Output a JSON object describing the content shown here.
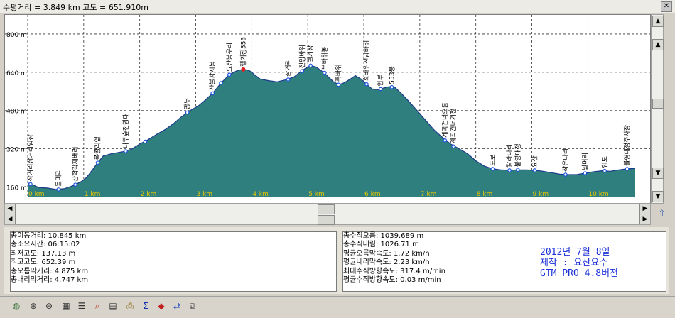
{
  "window": {
    "title": "수평거리 = 3.849 km    고도 =  651.910m"
  },
  "chart_data": {
    "type": "area",
    "ylim": [
      120,
      880
    ],
    "xlim": [
      0,
      10.845
    ],
    "y_ticks": [
      160,
      320,
      480,
      640,
      800
    ],
    "y_tick_labels": [
      "160 m",
      "320 m",
      "480 m",
      "640 m",
      "800 m"
    ],
    "x_ticks": [
      0,
      1,
      2,
      3,
      4,
      5,
      6,
      7,
      8,
      9,
      10
    ],
    "x_tick_labels": [
      "0 km",
      "1 km",
      "2 km",
      "3 km",
      "4 km",
      "5 km",
      "6 km",
      "7 km",
      "8 km",
      "9 km",
      "10 km"
    ],
    "grid": true,
    "fill_color": "#2f7f7f",
    "line_color": "#1b3a8a",
    "marker_color": "#1a55e0",
    "cursor_color": "#e02020",
    "profile": [
      [
        0.0,
        178
      ],
      [
        0.1,
        168
      ],
      [
        0.2,
        158
      ],
      [
        0.35,
        156
      ],
      [
        0.5,
        150
      ],
      [
        0.65,
        153
      ],
      [
        0.8,
        165
      ],
      [
        0.95,
        182
      ],
      [
        1.05,
        200
      ],
      [
        1.15,
        230
      ],
      [
        1.25,
        262
      ],
      [
        1.35,
        290
      ],
      [
        1.5,
        300
      ],
      [
        1.7,
        308
      ],
      [
        1.85,
        318
      ],
      [
        2.0,
        340
      ],
      [
        2.15,
        358
      ],
      [
        2.3,
        380
      ],
      [
        2.45,
        400
      ],
      [
        2.6,
        425
      ],
      [
        2.75,
        455
      ],
      [
        2.9,
        480
      ],
      [
        3.05,
        500
      ],
      [
        3.15,
        520
      ],
      [
        3.3,
        552
      ],
      [
        3.45,
        595
      ],
      [
        3.6,
        630
      ],
      [
        3.75,
        648
      ],
      [
        3.85,
        652
      ],
      [
        3.95,
        648
      ],
      [
        4.05,
        630
      ],
      [
        4.15,
        612
      ],
      [
        4.3,
        605
      ],
      [
        4.45,
        600
      ],
      [
        4.6,
        608
      ],
      [
        4.75,
        620
      ],
      [
        4.85,
        638
      ],
      [
        4.95,
        655
      ],
      [
        5.05,
        668
      ],
      [
        5.15,
        662
      ],
      [
        5.25,
        645
      ],
      [
        5.35,
        625
      ],
      [
        5.45,
        602
      ],
      [
        5.55,
        588
      ],
      [
        5.65,
        596
      ],
      [
        5.75,
        610
      ],
      [
        5.85,
        626
      ],
      [
        5.95,
        612
      ],
      [
        6.05,
        590
      ],
      [
        6.15,
        570
      ],
      [
        6.25,
        568
      ],
      [
        6.35,
        574
      ],
      [
        6.45,
        580
      ],
      [
        6.55,
        578
      ],
      [
        6.65,
        556
      ],
      [
        6.8,
        520
      ],
      [
        6.95,
        480
      ],
      [
        7.1,
        440
      ],
      [
        7.25,
        400
      ],
      [
        7.4,
        368
      ],
      [
        7.55,
        340
      ],
      [
        7.7,
        320
      ],
      [
        7.85,
        300
      ],
      [
        8.0,
        270
      ],
      [
        8.15,
        248
      ],
      [
        8.3,
        236
      ],
      [
        8.45,
        232
      ],
      [
        8.6,
        230
      ],
      [
        8.75,
        232
      ],
      [
        8.9,
        232
      ],
      [
        9.05,
        230
      ],
      [
        9.2,
        226
      ],
      [
        9.35,
        220
      ],
      [
        9.5,
        214
      ],
      [
        9.65,
        212
      ],
      [
        9.8,
        212
      ],
      [
        9.95,
        218
      ],
      [
        10.1,
        224
      ],
      [
        10.25,
        228
      ],
      [
        10.4,
        226
      ],
      [
        10.55,
        232
      ],
      [
        10.7,
        236
      ],
      [
        10.845,
        238
      ]
    ],
    "waypoints": [
      {
        "x": 0.05,
        "y": 172,
        "label": "장거리삼거리입장"
      },
      {
        "x": 0.55,
        "y": 150,
        "label": "들머리"
      },
      {
        "x": 0.85,
        "y": 170,
        "label": "산학각재배리"
      },
      {
        "x": 1.25,
        "y": 262,
        "label": "쪽칼리잎"
      },
      {
        "x": 1.75,
        "y": 310,
        "label": "나무숲전망대"
      },
      {
        "x": 2.1,
        "y": 350,
        "label": ""
      },
      {
        "x": 2.85,
        "y": 472,
        "label": "망부"
      },
      {
        "x": 3.3,
        "y": 552,
        "label": "산불감시봉"
      },
      {
        "x": 3.45,
        "y": 595,
        "label": ""
      },
      {
        "x": 3.6,
        "y": 630,
        "label": "요산봉우리"
      },
      {
        "x": 3.85,
        "y": 652,
        "label": "헬기장553"
      },
      {
        "x": 4.65,
        "y": 610,
        "label": "삼거리"
      },
      {
        "x": 4.9,
        "y": 645,
        "label": "전망바위"
      },
      {
        "x": 5.05,
        "y": 668,
        "label": "헬기장"
      },
      {
        "x": 5.3,
        "y": 638,
        "label": "부바위봉"
      },
      {
        "x": 5.55,
        "y": 588,
        "label": "흑바위"
      },
      {
        "x": 6.05,
        "y": 590,
        "label": "흑바위전망바위"
      },
      {
        "x": 6.3,
        "y": 570,
        "label": "안부"
      },
      {
        "x": 6.5,
        "y": 578,
        "label": "553봉"
      },
      {
        "x": 7.45,
        "y": 355,
        "label": "계곡건너오름"
      },
      {
        "x": 7.6,
        "y": 330,
        "label": "계곡건너기전"
      },
      {
        "x": 8.3,
        "y": 236,
        "label": "도로"
      },
      {
        "x": 8.6,
        "y": 230,
        "label": "칼라다리"
      },
      {
        "x": 8.75,
        "y": 232,
        "label": "불영대정"
      },
      {
        "x": 9.05,
        "y": 230,
        "label": "요산"
      },
      {
        "x": 9.6,
        "y": 212,
        "label": "작은다리"
      },
      {
        "x": 9.95,
        "y": 218,
        "label": "날머리"
      },
      {
        "x": 10.3,
        "y": 228,
        "label": "임도"
      },
      {
        "x": 10.7,
        "y": 236,
        "label": "불영대정주차장"
      }
    ],
    "cursor": {
      "x": 3.849,
      "y": 651.91
    }
  },
  "stats_left": [
    "총이동거리: 10.845 km",
    "총소요시간: 06:15:02",
    "최저고도: 137.13 m",
    "최고고도: 652.39 m",
    "총오름막거리: 4.875 km",
    "총내리막거리: 4.747 km"
  ],
  "stats_right": [
    "총수직오름: 1039.689 m",
    "총수직내림: 1026.71 m",
    "평균오름막속도: 1.72 km/h",
    "평균내리막속도: 2.23 km/h",
    "최대수직방향속도: 317.4 m/min",
    "평균수직방향속도: 0.03 m/min"
  ],
  "credits": {
    "line1": "2012년 7월 8일",
    "line2": "제작 : 요산요수",
    "line3": "GTM PRO 4.8버전"
  },
  "toolbar_icons": [
    "globe-icon",
    "zoom-in-icon",
    "zoom-out-icon",
    "grid-icon",
    "list-icon",
    "search-icon",
    "document-icon",
    "print-icon",
    "sigma-icon",
    "book-icon",
    "swap-icon",
    "export-icon"
  ]
}
